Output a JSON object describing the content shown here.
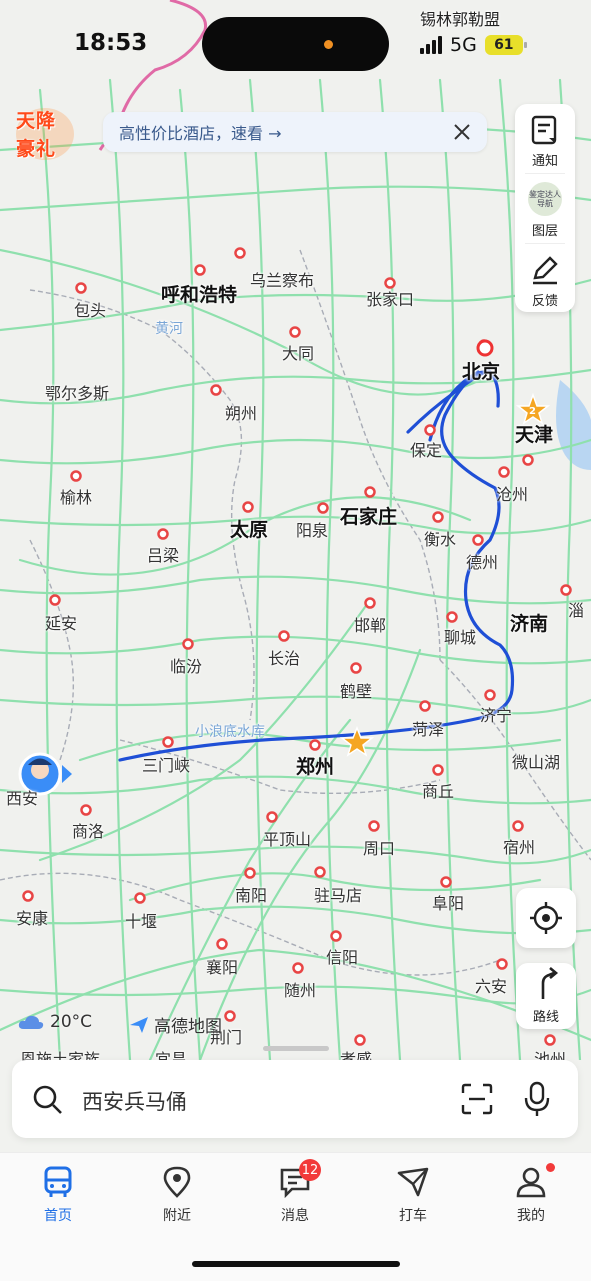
{
  "status_bar": {
    "time": "18:53",
    "location_label": "锡林郭勒盟",
    "network": "5G",
    "battery": "61"
  },
  "promo": {
    "badge_line1": "天降",
    "badge_line2": "豪礼",
    "banner_text": "高性价比酒店，速看 →"
  },
  "side_tools": [
    {
      "label": "通知",
      "icon": "notification-icon"
    },
    {
      "label": "图层",
      "icon": "layers-icon",
      "thumb_text": "鉴定达人导航"
    },
    {
      "label": "反馈",
      "icon": "feedback-icon"
    }
  ],
  "map": {
    "cities_major": [
      "呼和浩特",
      "北京",
      "天津",
      "太原",
      "石家庄",
      "济南",
      "郑州"
    ],
    "cities": [
      "乌兰察布",
      "包头",
      "张家口",
      "大同",
      "鄂尔多斯",
      "朔州",
      "保定",
      "沧州",
      "榆林",
      "阳泉",
      "衡水",
      "吕梁",
      "德州",
      "延安",
      "邯郸",
      "聊城",
      "淄",
      "临汾",
      "长治",
      "鹤壁",
      "菏泽",
      "济宁",
      "三门峡",
      "西安",
      "商丘",
      "微山湖",
      "商洛",
      "平顶山",
      "周口",
      "宿州",
      "南阳",
      "驻马店",
      "阜阳",
      "安康",
      "十堰",
      "信阳",
      "襄阳",
      "随州",
      "六安",
      "荆门",
      "恩施土家族",
      "宜昌",
      "孝感",
      "池州"
    ],
    "water": [
      "黄河",
      "小浪底水库"
    ],
    "waypoint_number": "2"
  },
  "weather": {
    "temp": "20°C",
    "icon": "cloud-icon"
  },
  "brand": {
    "name": "高德地图"
  },
  "search": {
    "placeholder": "西安兵马俑"
  },
  "tabs": [
    {
      "label": "首页",
      "icon": "bus-icon",
      "active": true
    },
    {
      "label": "附近",
      "icon": "location-pin-icon"
    },
    {
      "label": "消息",
      "icon": "message-icon",
      "badge": "12"
    },
    {
      "label": "打车",
      "icon": "taxi-icon"
    },
    {
      "label": "我的",
      "icon": "profile-icon",
      "dot": true
    }
  ],
  "route_button_label": "路线",
  "colors": {
    "accent": "#1f6fe6",
    "route": "#1f4fd6",
    "road": "#8fe0ad",
    "badge": "#f23a3a"
  }
}
